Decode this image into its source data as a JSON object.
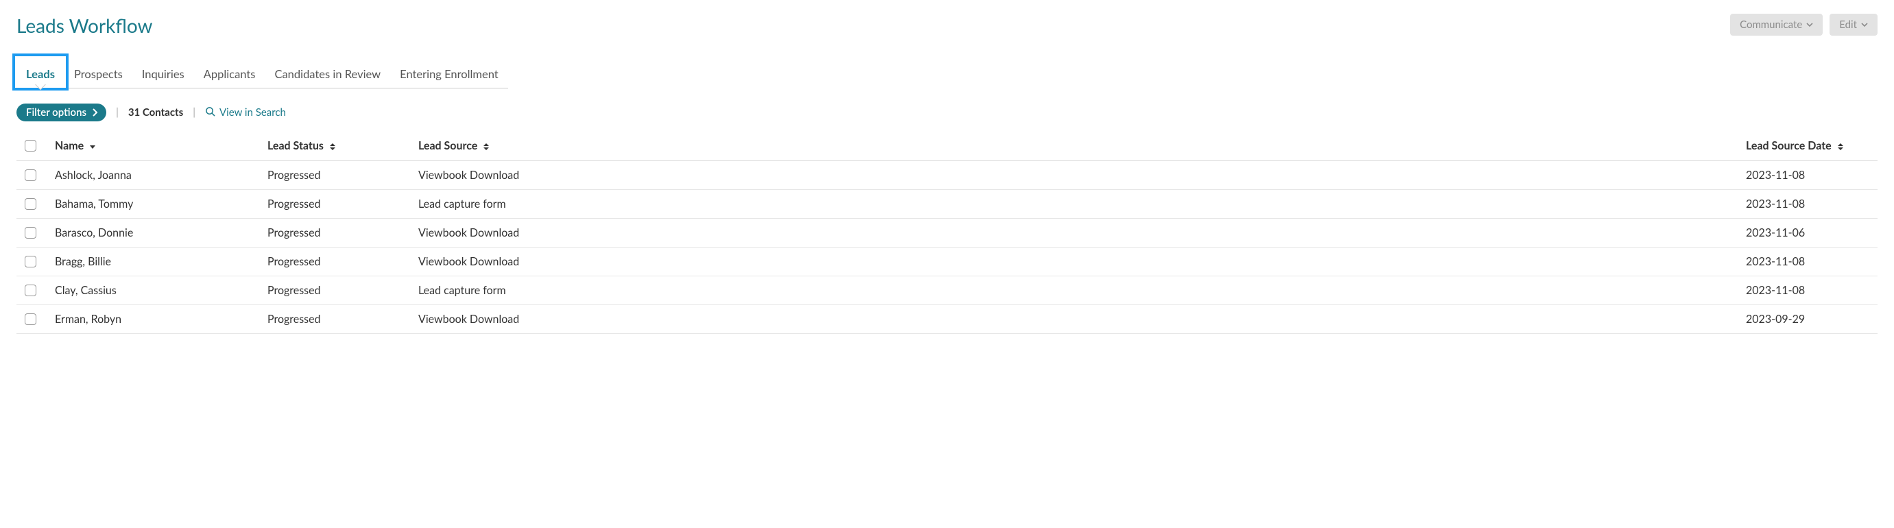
{
  "page": {
    "title": "Leads Workflow"
  },
  "header_buttons": {
    "communicate": "Communicate",
    "edit": "Edit"
  },
  "tabs": [
    {
      "label": "Leads",
      "active": true
    },
    {
      "label": "Prospects",
      "active": false
    },
    {
      "label": "Inquiries",
      "active": false
    },
    {
      "label": "Applicants",
      "active": false
    },
    {
      "label": "Candidates in Review",
      "active": false
    },
    {
      "label": "Entering Enrollment",
      "active": false
    }
  ],
  "filter": {
    "button_label": "Filter options",
    "contacts_text": "31 Contacts",
    "view_in_search": "View in Search"
  },
  "columns": {
    "name": "Name",
    "lead_status": "Lead Status",
    "lead_source": "Lead Source",
    "lead_source_date": "Lead Source Date"
  },
  "rows": [
    {
      "name": "Ashlock, Joanna",
      "status": "Progressed",
      "source": "Viewbook Download",
      "date": "2023-11-08"
    },
    {
      "name": "Bahama, Tommy",
      "status": "Progressed",
      "source": "Lead capture form",
      "date": "2023-11-08"
    },
    {
      "name": "Barasco, Donnie",
      "status": "Progressed",
      "source": "Viewbook Download",
      "date": "2023-11-06"
    },
    {
      "name": "Bragg, Billie",
      "status": "Progressed",
      "source": "Viewbook Download",
      "date": "2023-11-08"
    },
    {
      "name": "Clay, Cassius",
      "status": "Progressed",
      "source": "Lead capture form",
      "date": "2023-11-08"
    },
    {
      "name": "Erman, Robyn",
      "status": "Progressed",
      "source": "Viewbook Download",
      "date": "2023-09-29"
    }
  ]
}
